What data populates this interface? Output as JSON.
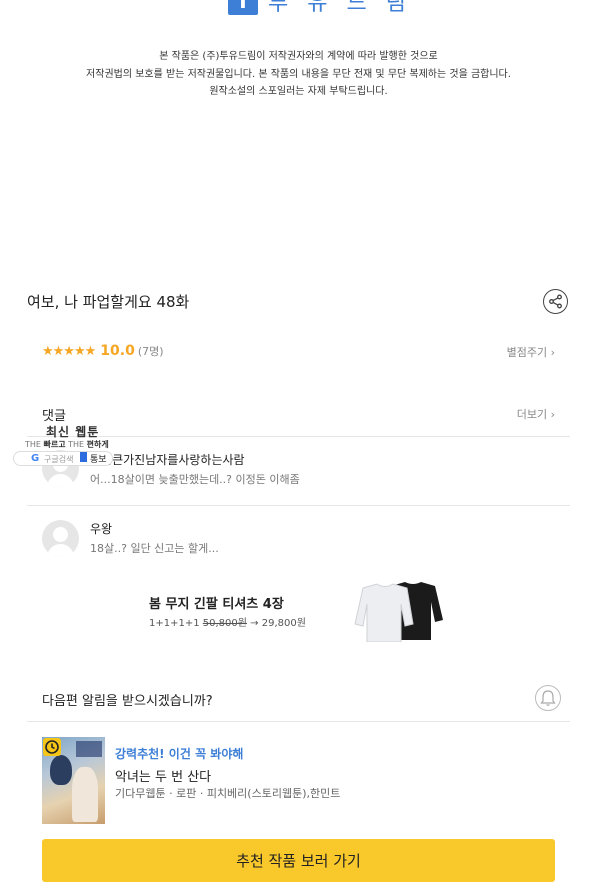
{
  "header": {
    "logo_mark": "T",
    "logo_text": "투 유 드 림",
    "notice_lines": [
      "본 작품은 (주)투유드림이 저작권자와의 계약에 따라 발행한 것으로",
      "저작권법의 보호를 받는 저작권물입니다. 본 작품의 내용을 무단 전재 및 무단 복제하는 것을 금합니다.",
      "원작소설의 스포일러는 자제 부탁드립니다."
    ]
  },
  "episode": {
    "title": "여보, 나 파업할게요 48화",
    "share_icon": "share-icon"
  },
  "rating": {
    "stars": "★★★★★",
    "score": "10.0",
    "count": "(7명)",
    "rate_link": "별점주기 ›",
    "star_color": "#f5a623"
  },
  "comments": {
    "heading": "댓글",
    "more_link": "더보기 ›",
    "items": [
      {
        "name": "가슴큰가진남자를사랑하는사람",
        "text": "어...18살이면 늦출만했는데..? 이정돈 이해좀"
      },
      {
        "name": "우왕",
        "text": "18살..? 일단 신고는 할게..."
      }
    ]
  },
  "overlay": {
    "title": "최신 웹툰",
    "small_left": "THE",
    "small_bold": "빠르고",
    "small_mid": "THE",
    "small_bold2": "편하게",
    "search_label": "구글검색",
    "tong_label": "통보"
  },
  "ad": {
    "title": "봄 무지 긴팔 티셔츠 4장",
    "price_prefix": "1+1+1+1",
    "price_original": "50,800원",
    "price_arrow": " → ",
    "price_sale": "29,800원"
  },
  "notify": {
    "text": "다음편 알림을 받으시겠습니까?",
    "bell_icon": "bell-icon"
  },
  "recommend": {
    "label": "강력추천! 이건 꼭 봐야해",
    "title": "악녀는 두 번 산다",
    "meta": "기다무웹툰 · 로판 · 피치베리(스토리웹툰),한민트",
    "cta": "추천 작품 보러 가기",
    "cta_color": "#f9c82b"
  }
}
